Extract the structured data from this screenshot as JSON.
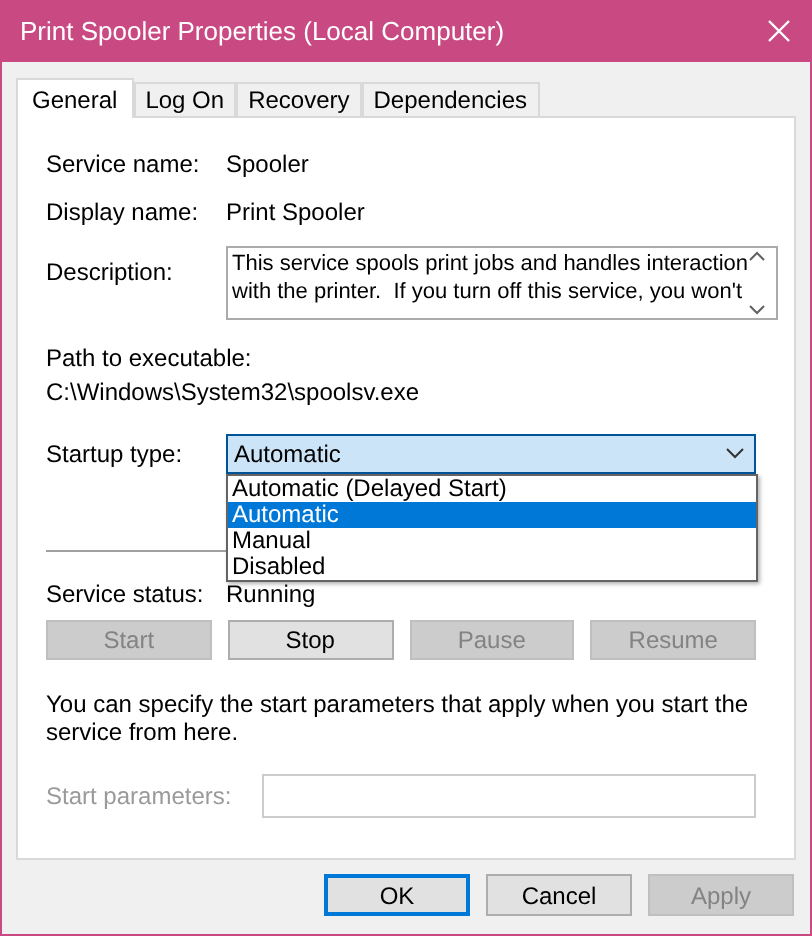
{
  "window": {
    "title": "Print Spooler Properties (Local Computer)"
  },
  "tabs": [
    {
      "label": "General",
      "selected": true
    },
    {
      "label": "Log On",
      "selected": false
    },
    {
      "label": "Recovery",
      "selected": false
    },
    {
      "label": "Dependencies",
      "selected": false
    }
  ],
  "service_name": {
    "label": "Service name:",
    "value": "Spooler"
  },
  "display_name": {
    "label": "Display name:",
    "value": "Print Spooler"
  },
  "description": {
    "label": "Description:",
    "lines": [
      "This service spools print jobs and handles interaction",
      "with the printer.  If you turn off this service, you won't"
    ]
  },
  "path": {
    "label": "Path to executable:",
    "value": "C:\\Windows\\System32\\spoolsv.exe"
  },
  "startup_type": {
    "label": "Startup type:",
    "value": "Automatic",
    "expanded": true,
    "options": [
      {
        "label": "Automatic (Delayed Start)",
        "selected": false
      },
      {
        "label": "Automatic",
        "selected": true
      },
      {
        "label": "Manual",
        "selected": false
      },
      {
        "label": "Disabled",
        "selected": false
      }
    ]
  },
  "service_status": {
    "label": "Service status:",
    "value": "Running"
  },
  "service_buttons": [
    {
      "label": "Start",
      "disabled": true
    },
    {
      "label": "Stop",
      "disabled": false
    },
    {
      "label": "Pause",
      "disabled": true
    },
    {
      "label": "Resume",
      "disabled": true
    }
  ],
  "hint": "You can specify the start parameters that apply when you start the service from here.",
  "start_parameters": {
    "label": "Start parameters:",
    "disabled": true
  },
  "dialog_buttons": [
    {
      "label": "OK",
      "disabled": false,
      "default": true
    },
    {
      "label": "Cancel",
      "disabled": false,
      "default": false
    },
    {
      "label": "Apply",
      "disabled": true,
      "default": false
    }
  ]
}
